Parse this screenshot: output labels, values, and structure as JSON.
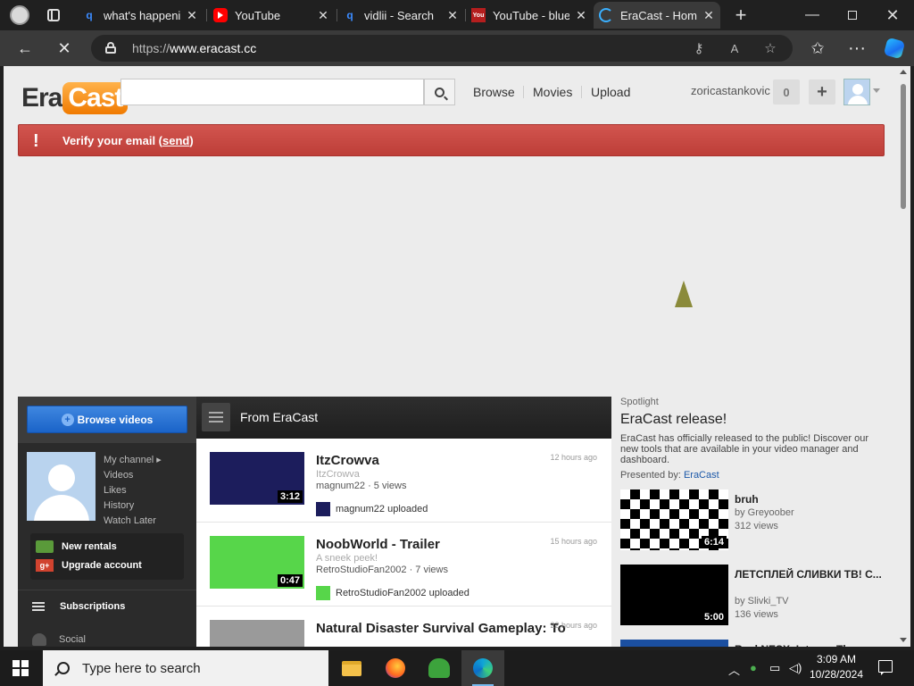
{
  "browser": {
    "tabs": [
      {
        "title": "what's happening",
        "favicon": "bing-search-icon"
      },
      {
        "title": "YouTube",
        "favicon": "youtube-icon"
      },
      {
        "title": "vidlii - Search",
        "favicon": "bing-search-icon"
      },
      {
        "title": "YouTube - blue",
        "favicon": "youtube-old-icon"
      },
      {
        "title": "EraCast - Home",
        "favicon": "loading-spinner-icon"
      }
    ],
    "url_scheme": "https://",
    "url_host": "www.eracast.cc"
  },
  "site": {
    "logo": {
      "left": "Era",
      "right": "Cast"
    },
    "search_placeholder": "",
    "nav": [
      "Browse",
      "Movies",
      "Upload"
    ],
    "username": "zoricastankovic",
    "notification_count": "0",
    "upload_plus": "+"
  },
  "banner": {
    "icon": "!",
    "text_before": "Verify your email (",
    "link": "send",
    "text_after": ")"
  },
  "guide": {
    "browse_button": "Browse videos",
    "links": [
      "My channel ▸",
      "Videos",
      "Likes",
      "History",
      "Watch Later"
    ],
    "extras": [
      {
        "icon_text": "",
        "label": "New rentals"
      },
      {
        "icon_text": "g+",
        "label": "Upgrade account"
      }
    ],
    "subscriptions": "Subscriptions",
    "social": "Social"
  },
  "feed": {
    "title": "From EraCast",
    "items": [
      {
        "title": "ItzCrowva",
        "subtitle": "ItzCrowva",
        "meta": "magnum22 · 5 views",
        "age": "12 hours ago",
        "duration": "3:12",
        "uploader_line": "magnum22 uploaded",
        "thumb_color": "#1c1d5c"
      },
      {
        "title": "NoobWorld - Trailer",
        "subtitle": "A sneek peek!",
        "meta": "RetroStudioFan2002 · 7 views",
        "age": "15 hours ago",
        "duration": "0:47",
        "uploader_line": "RetroStudioFan2002 uploaded",
        "thumb_color": "#57d64a"
      },
      {
        "title": "Natural Disaster Survival Gameplay: To",
        "subtitle": "",
        "meta": "",
        "age": "22 hours ago",
        "duration": "",
        "uploader_line": "",
        "thumb_color": "#9a9a9a"
      }
    ]
  },
  "spotlight": {
    "label": "Spotlight",
    "title": "EraCast release!",
    "description": "EraCast has officially released to the public! Discover our new tools that are available in your video manager and dashboard.",
    "presented_by_label": "Presented by: ",
    "presented_by": "EraCast",
    "items": [
      {
        "title": "bruh",
        "by": "by Greyoober",
        "views": "312 views",
        "duration": "6:14",
        "thumb_style": "checker"
      },
      {
        "title": "ЛЕТСПЛЕЙ СЛИВКИ ТВ! С...",
        "by": "by Slivki_TV",
        "views": "136 views",
        "duration": "5:00",
        "thumb_style": "black"
      },
      {
        "title": "RockNESX_Intceps The",
        "by": "",
        "views": "",
        "duration": "",
        "thumb_style": "blue"
      }
    ]
  },
  "taskbar": {
    "search_placeholder": "Type here to search",
    "apps": [
      "file-explorer-icon",
      "firefox-icon",
      "people-app-icon",
      "edge-icon"
    ],
    "time": "3:09 AM",
    "date": "10/28/2024"
  },
  "colors": {
    "banner_red": "#c8463f",
    "browse_blue": "#2a74d6",
    "guide_dark": "#2b2b2b",
    "logo_orange": "#f7941d"
  }
}
